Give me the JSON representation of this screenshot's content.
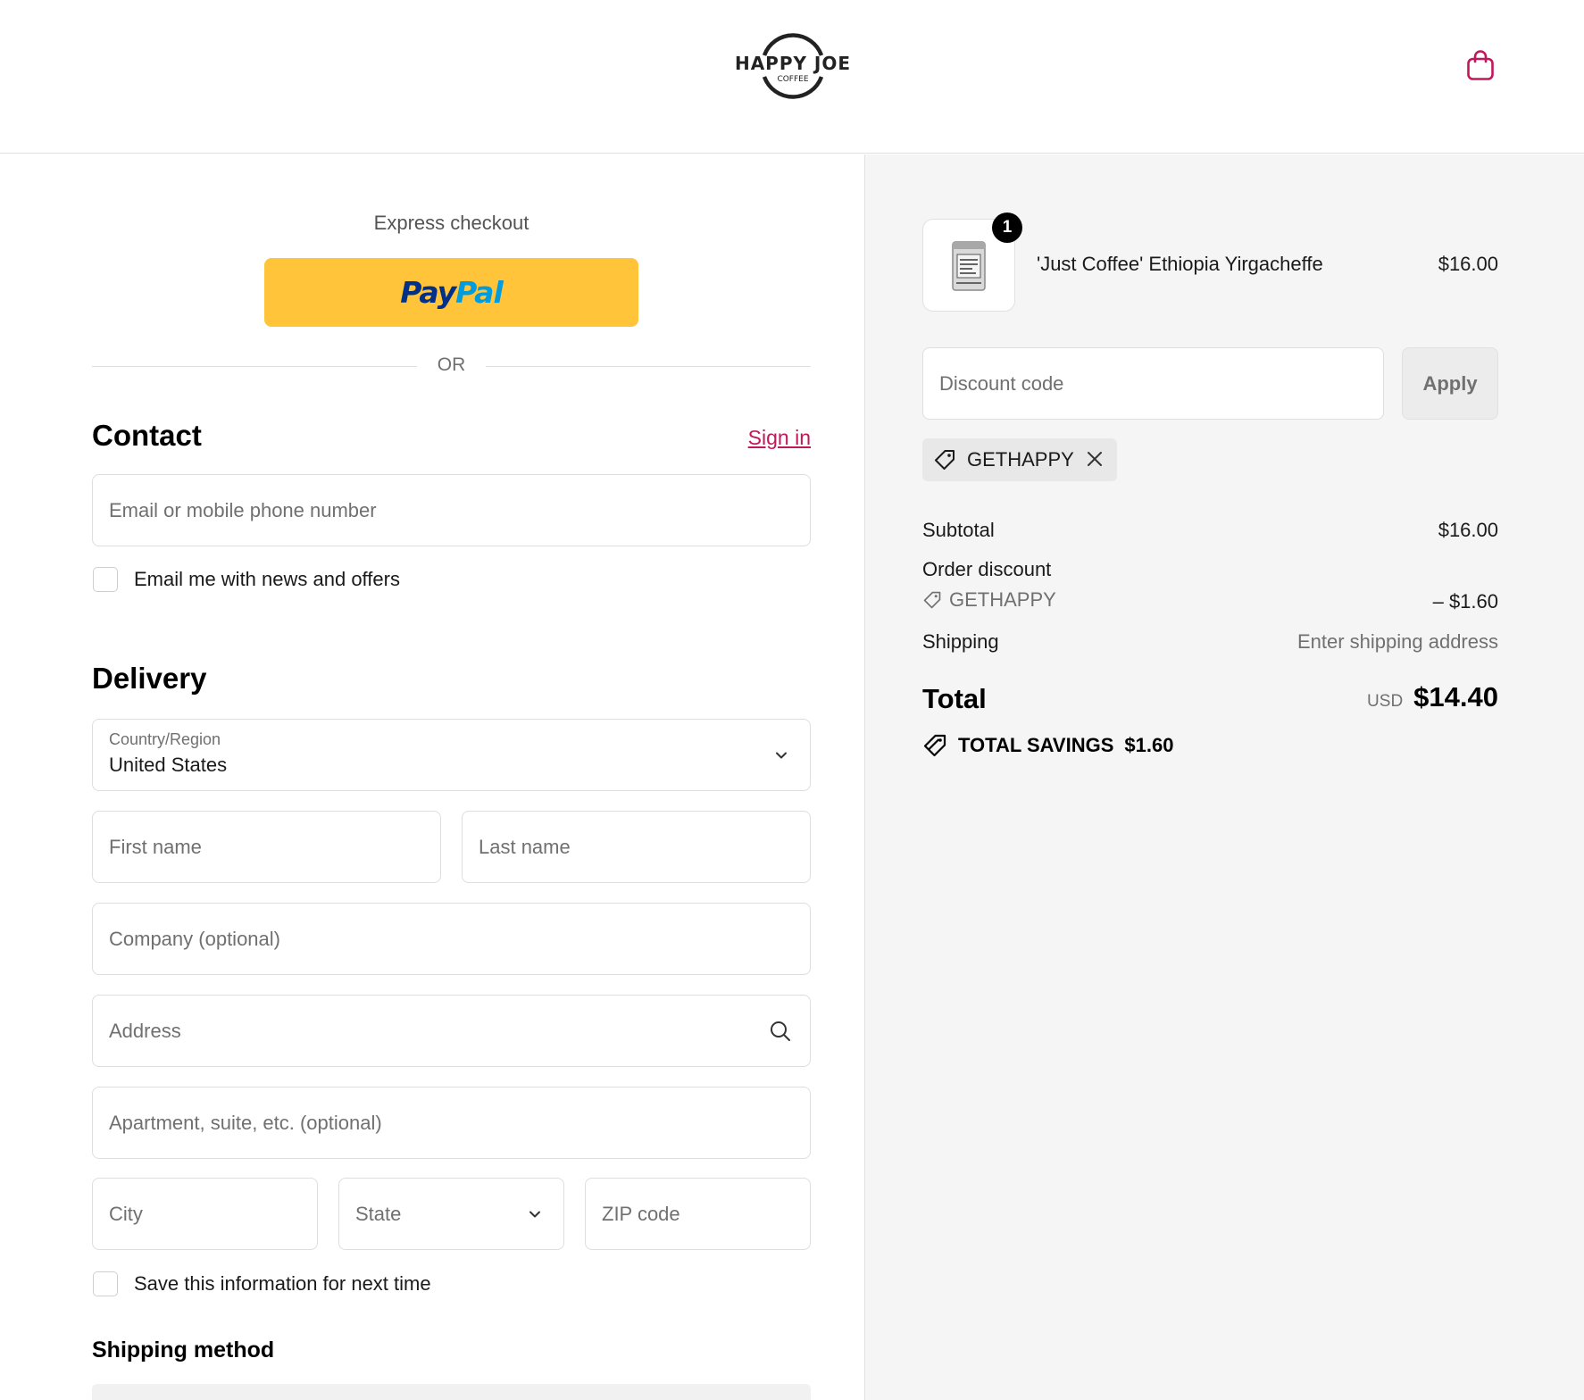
{
  "header": {
    "logo": {
      "top_text": "HAPPY JOE",
      "bottom_text": "COFFEE"
    },
    "cart_icon": "shopping-bag-icon",
    "accent_color": "#c2185b"
  },
  "express": {
    "title": "Express checkout",
    "paypal": {
      "pay": "Pay",
      "pal": "Pal",
      "bg_color": "#ffc439"
    },
    "or_label": "OR"
  },
  "contact": {
    "title": "Contact",
    "sign_in": "Sign in",
    "email_placeholder": "Email or mobile phone number",
    "news_label": "Email me with news and offers",
    "news_checked": false
  },
  "delivery": {
    "title": "Delivery",
    "country": {
      "label": "Country/Region",
      "value": "United States"
    },
    "first_name": "First name",
    "last_name": "Last name",
    "company": "Company (optional)",
    "address": "Address",
    "apartment": "Apartment, suite, etc. (optional)",
    "city": "City",
    "state": "State",
    "zip": "ZIP code",
    "save_label": "Save this information for next time",
    "save_checked": false
  },
  "shipping_method": {
    "title": "Shipping method"
  },
  "summary": {
    "item": {
      "name": "'Just Coffee' Ethiopia Yirgacheffe",
      "price": "$16.00",
      "quantity": "1"
    },
    "discount": {
      "placeholder": "Discount code",
      "apply": "Apply",
      "applied_code": "GETHAPPY"
    },
    "subtotal": {
      "label": "Subtotal",
      "value": "$16.00"
    },
    "order_discount": {
      "label": "Order discount",
      "code": "GETHAPPY",
      "value": "– $1.60"
    },
    "shipping": {
      "label": "Shipping",
      "value": "Enter shipping address"
    },
    "total": {
      "label": "Total",
      "currency": "USD",
      "value": "$14.40"
    },
    "savings": {
      "label": "TOTAL SAVINGS",
      "value": "$1.60"
    }
  }
}
